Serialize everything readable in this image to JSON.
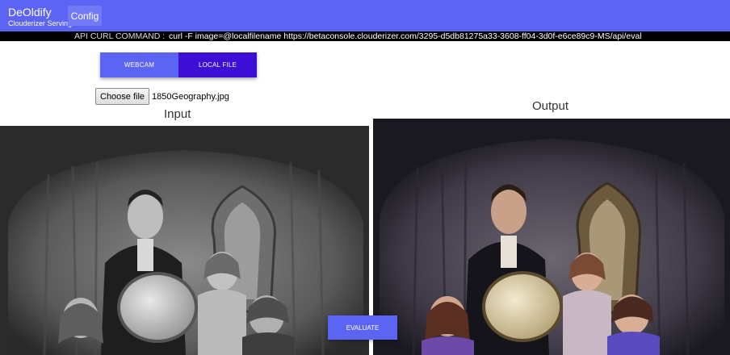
{
  "app": {
    "title": "DeOldify",
    "subtitle": "Clouderizer Serving",
    "config_label": "Config"
  },
  "api": {
    "label": "API CURL COMMAND :",
    "command": "curl -F image=@localfilename https://betaconsole.clouderizer.com/3295-d5db81275a33-3608-ff04-3d0f-e6ce89c9-MS/api/eval"
  },
  "tabs": [
    {
      "label": "WEBCAM",
      "active": false
    },
    {
      "label": "LOCAL FILE",
      "active": true
    }
  ],
  "file": {
    "button_label": "Choose file",
    "selected_name": "1850Geography.jpg"
  },
  "input": {
    "label": "Input"
  },
  "output": {
    "label": "Output"
  },
  "actions": {
    "evaluate_label": "EVALUATE"
  },
  "colors": {
    "accent": "#5c64f4",
    "active_tab": "#3d0fd6"
  }
}
